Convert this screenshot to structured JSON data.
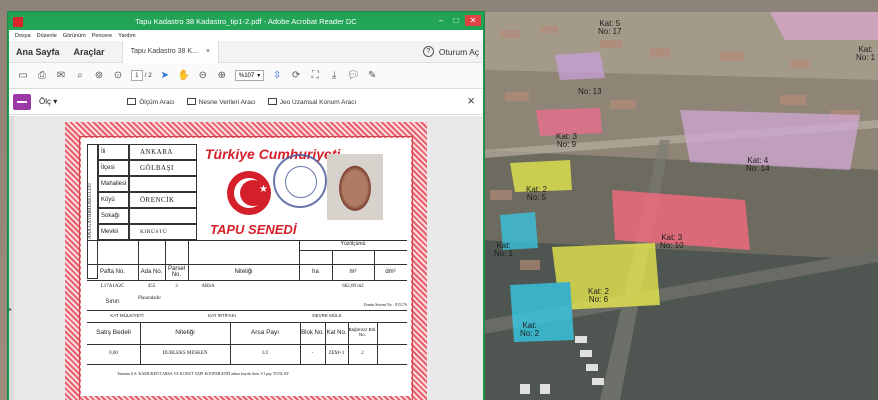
{
  "window": {
    "title": "Tapu Kadastro 38 Kadastro_tip1-2.pdf - Adobe Acrobat Reader DC",
    "min_glyph": "–",
    "max_glyph": "□",
    "close_glyph": "✕"
  },
  "menu": [
    "Dosya",
    "Düzenle",
    "Görünüm",
    "Pencere",
    "Yardım"
  ],
  "tabs": {
    "home": "Ana Sayfa",
    "tools": "Araçlar",
    "document": "Tapu Kadastro 38 K...",
    "document_close": "×",
    "help": "?",
    "signin": "Oturum Aç"
  },
  "toolbar": {
    "page_current": "1",
    "page_total": "/ 2",
    "zoom": "%107"
  },
  "measure": {
    "label": "Ölç ▾",
    "tools": [
      "Ölçüm Aracı",
      "Nesne Verileri Aracı",
      "Jeo Uzamsal Konum Aracı"
    ],
    "close": "×"
  },
  "deed": {
    "vertical_label": "ANA GAYRİMENKULÜN",
    "fields": [
      {
        "label": "İli",
        "value": "ANKARA"
      },
      {
        "label": "İlçesi",
        "value": "GÖLBAŞI"
      },
      {
        "label": "Mahallesi",
        "value": ""
      },
      {
        "label": "Köyü",
        "value": "ÖRENCİK"
      },
      {
        "label": "Sokağı",
        "value": ""
      },
      {
        "label": "Mevkii",
        "value": "KIRÜSTÜ"
      }
    ],
    "header_title": "Türkiye Cumhuriyeti",
    "deed_title": "TAPU SENEDİ",
    "table_headers": [
      "Pafta No.",
      "Ada No.",
      "Parsel No.",
      "Niteliği",
      "Yüzölçümü",
      "ha",
      "m²",
      "dm²"
    ],
    "row": [
      "L17A1A2C",
      "455",
      "3",
      "ARSA",
      "",
      "662,00 m2",
      ""
    ],
    "sinir_label": "Sınırı",
    "sinir_value": "Planındadır",
    "zemin": "Zemin Sistem No : 815176",
    "kat_labels": [
      "KAT MÜLKİYETİ",
      "KAT İRTİFAKI",
      "DEVRE MÜLK"
    ],
    "lower_headers": [
      "Satış Bedeli",
      "Niteliği",
      "Arsa Payı",
      "Blok No.",
      "Kat No.",
      "Bağımsız Böl. No."
    ],
    "lower_row": [
      "0,00",
      "DUBLEKS MESKEN",
      "1/2",
      "-",
      "ZEM+1",
      "2"
    ],
    "footer": "Tamamı S.S. KAMUKENT ARSA VE KONUT YAPI KOOPERATİFİ adına kayıtlı iken 1/1 pay TUNCAY"
  },
  "scene_labels": [
    {
      "lines": [
        "Kat: 5",
        "No: 17"
      ]
    },
    {
      "lines": [
        "Kat:",
        "No: 1"
      ]
    },
    {
      "lines": [
        "No: 13"
      ]
    },
    {
      "lines": [
        "Kat: 3",
        "No: 9"
      ]
    },
    {
      "lines": [
        "Kat: 4",
        "No: 14"
      ]
    },
    {
      "lines": [
        "Kat: 2",
        "No: 5"
      ]
    },
    {
      "lines": [
        "Kat: 3",
        "No: 10"
      ]
    },
    {
      "lines": [
        "Kat:",
        "No: 1"
      ]
    },
    {
      "lines": [
        "Kat: 2",
        "No: 6"
      ]
    },
    {
      "lines": [
        "Kat:",
        "No: 2"
      ]
    }
  ]
}
